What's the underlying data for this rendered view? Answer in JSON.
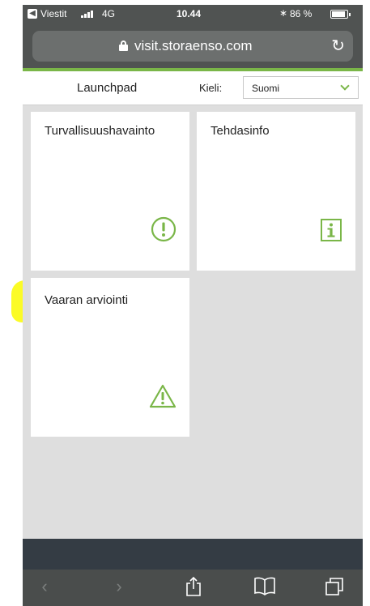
{
  "status_bar": {
    "carrier": "Viestit",
    "network": "4G",
    "time": "10.44",
    "battery": "86 %"
  },
  "browser": {
    "url": "visit.storaenso.com"
  },
  "header": {
    "title": "Launchpad",
    "language_label": "Kieli:",
    "language_value": "Suomi"
  },
  "tiles": [
    {
      "label": "Turvallisuushavainto",
      "icon": "exclamation-circle-icon"
    },
    {
      "label": "Tehdasinfo",
      "icon": "info-icon"
    },
    {
      "label": "Vaaran arviointi",
      "icon": "warning-triangle-icon"
    }
  ],
  "colors": {
    "accent": "#7ab648",
    "highlight": "#fbfb1a",
    "browser_chrome": "#505352"
  }
}
